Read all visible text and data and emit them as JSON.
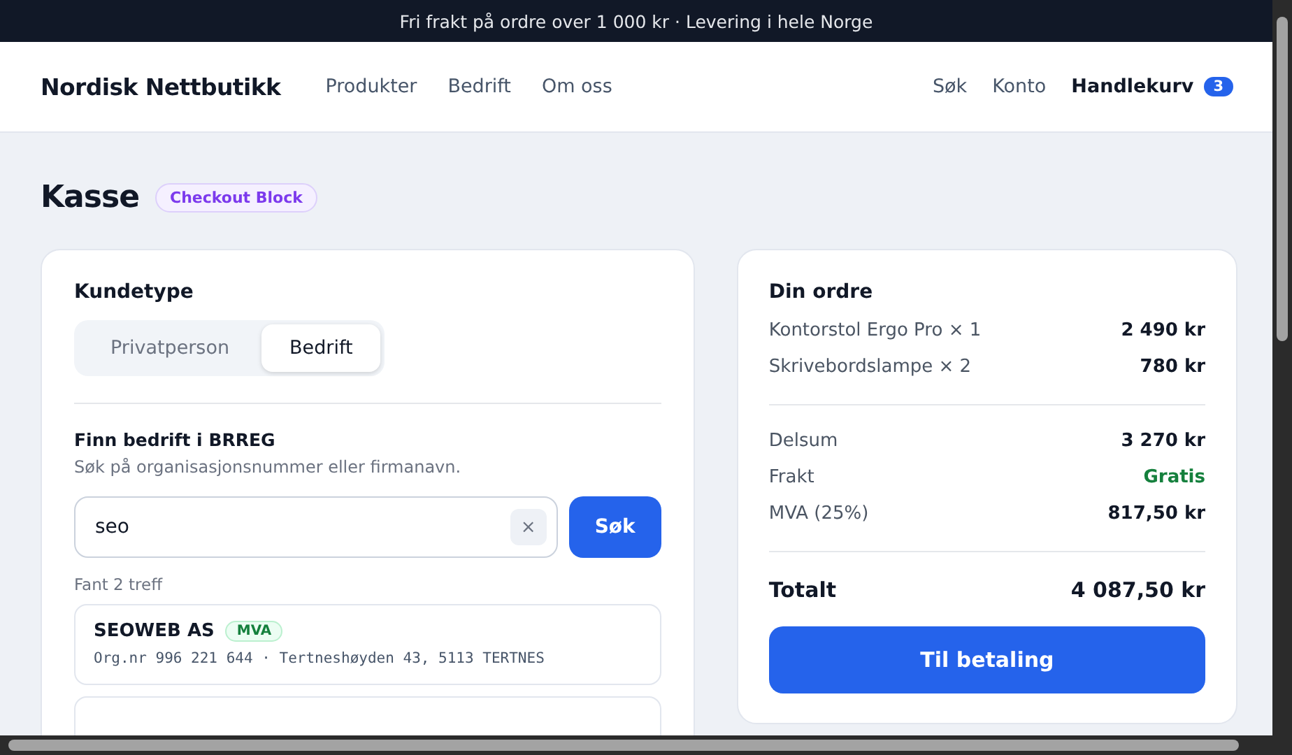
{
  "announcement": "Fri frakt på ordre over 1 000 kr · Levering i hele Norge",
  "header": {
    "logo": "Nordisk Nettbutikk",
    "nav": [
      "Produkter",
      "Bedrift",
      "Om oss"
    ],
    "actions": [
      {
        "label": "Søk",
        "bold": false
      },
      {
        "label": "Konto",
        "bold": false
      },
      {
        "label": "Handlekurv",
        "bold": true,
        "badge": "3"
      }
    ]
  },
  "page": {
    "title": "Kasse",
    "tag": "Checkout Block"
  },
  "customer": {
    "heading": "Kundetype",
    "segments": [
      {
        "label": "Privatperson",
        "selected": false
      },
      {
        "label": "Bedrift",
        "selected": true
      }
    ],
    "lookup": {
      "heading": "Finn bedrift i BRREG",
      "hint": "Søk på organisasjonsnummer eller firmanavn.",
      "value": "seo",
      "clear": "×",
      "button": "Søk"
    },
    "result_count": "Fant 2 treff",
    "results": [
      {
        "name": "SEOWEB AS",
        "tag": "MVA",
        "details": "Org.nr 996 221 644 · Tertneshøyden 43, 5113 TERTNES"
      },
      {
        "kind": "cut_off"
      }
    ]
  },
  "order": {
    "heading": "Din ordre",
    "items": [
      {
        "label": "Kontorstol Ergo Pro × 1",
        "value": "2 490 kr"
      },
      {
        "label": "Skrivebordslampe × 2",
        "value": "780 kr"
      }
    ],
    "summary": [
      {
        "label": "Delsum",
        "value": "3 270 kr"
      },
      {
        "label": "Frakt",
        "value": "Gratis",
        "color": "#15803d"
      },
      {
        "label": "MVA (25%)",
        "value": "817,50 kr"
      }
    ],
    "total": {
      "label": "Totalt",
      "value": "4 087,50 kr"
    },
    "button": "Til betaling"
  }
}
